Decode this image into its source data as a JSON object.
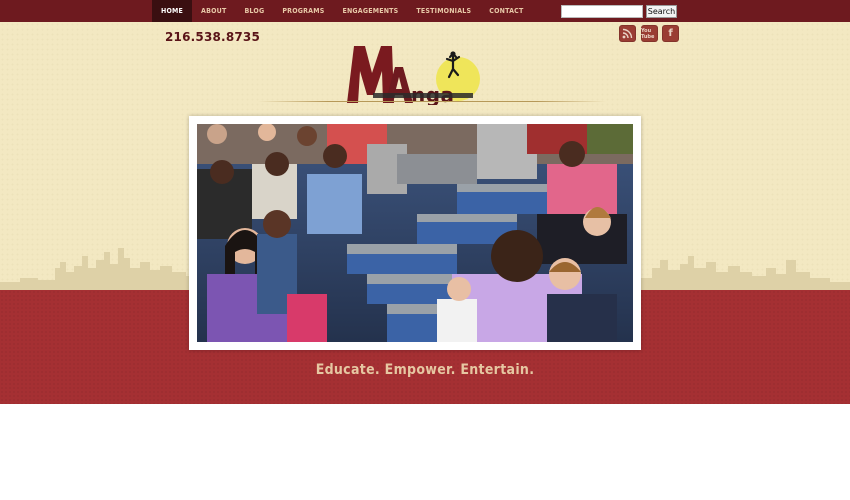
{
  "nav": {
    "items": [
      {
        "label": "HOME",
        "active": true
      },
      {
        "label": "ABOUT",
        "active": false
      },
      {
        "label": "BLOG",
        "active": false
      },
      {
        "label": "PROGRAMS",
        "active": false
      },
      {
        "label": "ENGAGEMENTS",
        "active": false
      },
      {
        "label": "TESTIMONIALS",
        "active": false
      },
      {
        "label": "CONTACT",
        "active": false
      }
    ]
  },
  "search": {
    "value": "",
    "button_label": "Search"
  },
  "header": {
    "phone": "216.538.8735",
    "logo_text": "MAnga"
  },
  "social": {
    "rss_icon": "rss-icon",
    "youtube_label": "You Tube",
    "youtube_icon": "youtube-icon",
    "facebook_label": "f",
    "facebook_icon": "facebook-icon"
  },
  "hero": {
    "image": "photo of students seated on bleachers"
  },
  "tagline": "Educate. Empower. Entertain.",
  "colors": {
    "nav_bg": "#6e1a1f",
    "nav_active_bg": "#3a0f11",
    "cream_bg": "#f3e8c2",
    "red_band": "#a53033",
    "tagline": "#e6c7a2",
    "logo_red": "#7a1a1f",
    "logo_sun": "#efe55a"
  }
}
